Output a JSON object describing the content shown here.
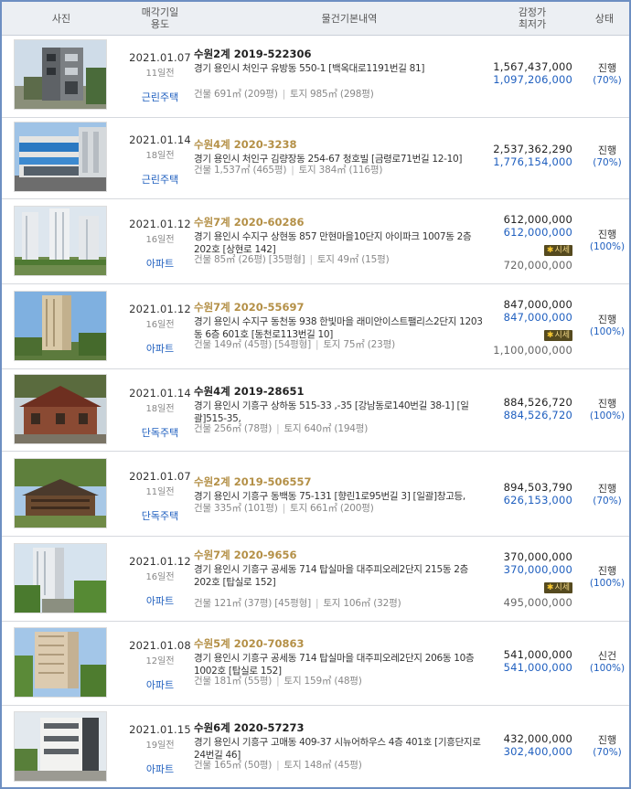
{
  "header": {
    "photo": "사진",
    "date_usage_line1": "매각기일",
    "date_usage_line2": "용도",
    "basic_info": "물건기본내역",
    "price_line1": "감정가",
    "price_line2": "최저가",
    "status": "상태"
  },
  "market_badge_label": "시세",
  "items": [
    {
      "date": "2021.01.07",
      "days_left": "11일전",
      "usage": "근린주택",
      "case_no": "수원2계 2019-522306",
      "case_style": "black",
      "address": "경기 용인시 처인구 유방동 550-1 [백옥대로1191번길 81]",
      "building_area": "건물 691㎡ (209평)",
      "land_area": "토지 985㎡ (298평)",
      "appraisal": "1,567,437,000",
      "minimum": "1,097,206,000",
      "market": "",
      "status": "진행",
      "percent": "(70%)"
    },
    {
      "date": "2021.01.14",
      "days_left": "18일전",
      "usage": "근린주택",
      "case_no": "수원4계 2020-3238",
      "case_style": "gold",
      "address": "경기 용인시 처인구 김량장동 254-67 청호빌 [금령로71번길 12-10]",
      "building_area": "건물 1,537㎡ (465평)",
      "land_area": "토지 384㎡ (116평)",
      "appraisal": "2,537,362,290",
      "minimum": "1,776,154,000",
      "market": "",
      "status": "진행",
      "percent": "(70%)"
    },
    {
      "date": "2021.01.12",
      "days_left": "16일전",
      "usage": "아파트",
      "case_no": "수원7계 2020-60286",
      "case_style": "gold",
      "address": "경기 용인시 수지구 상현동 857 만현마을10단지 아이파크 1007동 2층 202호 [상현로 142]",
      "building_area": "건물 85㎡ (26평) [35평형]",
      "land_area": "토지 49㎡ (15평)",
      "appraisal": "612,000,000",
      "minimum": "612,000,000",
      "market": "720,000,000",
      "status": "진행",
      "percent": "(100%)"
    },
    {
      "date": "2021.01.12",
      "days_left": "16일전",
      "usage": "아파트",
      "case_no": "수원7계 2020-55697",
      "case_style": "gold",
      "address": "경기 용인시 수지구 동천동 938 한빛마을 래미안이스트팰리스2단지 1203동 6층 601호 [동천로113번길 10]",
      "building_area": "건물 149㎡ (45평) [54평형]",
      "land_area": "토지 75㎡ (23평)",
      "appraisal": "847,000,000",
      "minimum": "847,000,000",
      "market": "1,100,000,000",
      "status": "진행",
      "percent": "(100%)"
    },
    {
      "date": "2021.01.14",
      "days_left": "18일전",
      "usage": "단독주택",
      "case_no": "수원4계 2019-28651",
      "case_style": "black",
      "address": "경기 용인시 기흥구 상하동 515-33 ,-35 [강남동로140번길 38-1] [일괄]515-35,",
      "building_area": "건물 256㎡ (78평)",
      "land_area": "토지 640㎡ (194평)",
      "appraisal": "884,526,720",
      "minimum": "884,526,720",
      "market": "",
      "status": "진행",
      "percent": "(100%)"
    },
    {
      "date": "2021.01.07",
      "days_left": "11일전",
      "usage": "단독주택",
      "case_no": "수원2계 2019-506557",
      "case_style": "gold",
      "address": "경기 용인시 기흥구 동백동 75-131 [향린1로95번길 3] [일괄]창고등,",
      "building_area": "건물 335㎡ (101평)",
      "land_area": "토지 661㎡ (200평)",
      "appraisal": "894,503,790",
      "minimum": "626,153,000",
      "market": "",
      "status": "진행",
      "percent": "(70%)"
    },
    {
      "date": "2021.01.12",
      "days_left": "16일전",
      "usage": "아파트",
      "case_no": "수원7계 2020-9656",
      "case_style": "gold",
      "address": "경기 용인시 기흥구 공세동 714 탑실마을 대주피오레2단지 215동 2층 202호 [탑실로 152]",
      "building_area": "건물 121㎡ (37평) [45평형]",
      "land_area": "토지 106㎡ (32평)",
      "appraisal": "370,000,000",
      "minimum": "370,000,000",
      "market": "495,000,000",
      "status": "진행",
      "percent": "(100%)"
    },
    {
      "date": "2021.01.08",
      "days_left": "12일전",
      "usage": "아파트",
      "case_no": "수원5계 2020-70863",
      "case_style": "gold",
      "address": "경기 용인시 기흥구 공세동 714 탑실마을 대주피오레2단지 206동 10층 1002호 [탑실로 152]",
      "building_area": "건물 181㎡ (55평)",
      "land_area": "토지 159㎡ (48평)",
      "appraisal": "541,000,000",
      "minimum": "541,000,000",
      "market": "",
      "status": "신건",
      "percent": "(100%)"
    },
    {
      "date": "2021.01.15",
      "days_left": "19일전",
      "usage": "아파트",
      "case_no": "수원6계 2020-57273",
      "case_style": "black",
      "address": "경기 용인시 기흥구 고매동 409-37 시뉴어하우스 4층 401호 [기흥단지로 24번길 46]",
      "building_area": "건물 165㎡ (50평)",
      "land_area": "토지 148㎡ (45평)",
      "appraisal": "432,000,000",
      "minimum": "302,400,000",
      "market": "",
      "status": "진행",
      "percent": "(70%)"
    }
  ]
}
